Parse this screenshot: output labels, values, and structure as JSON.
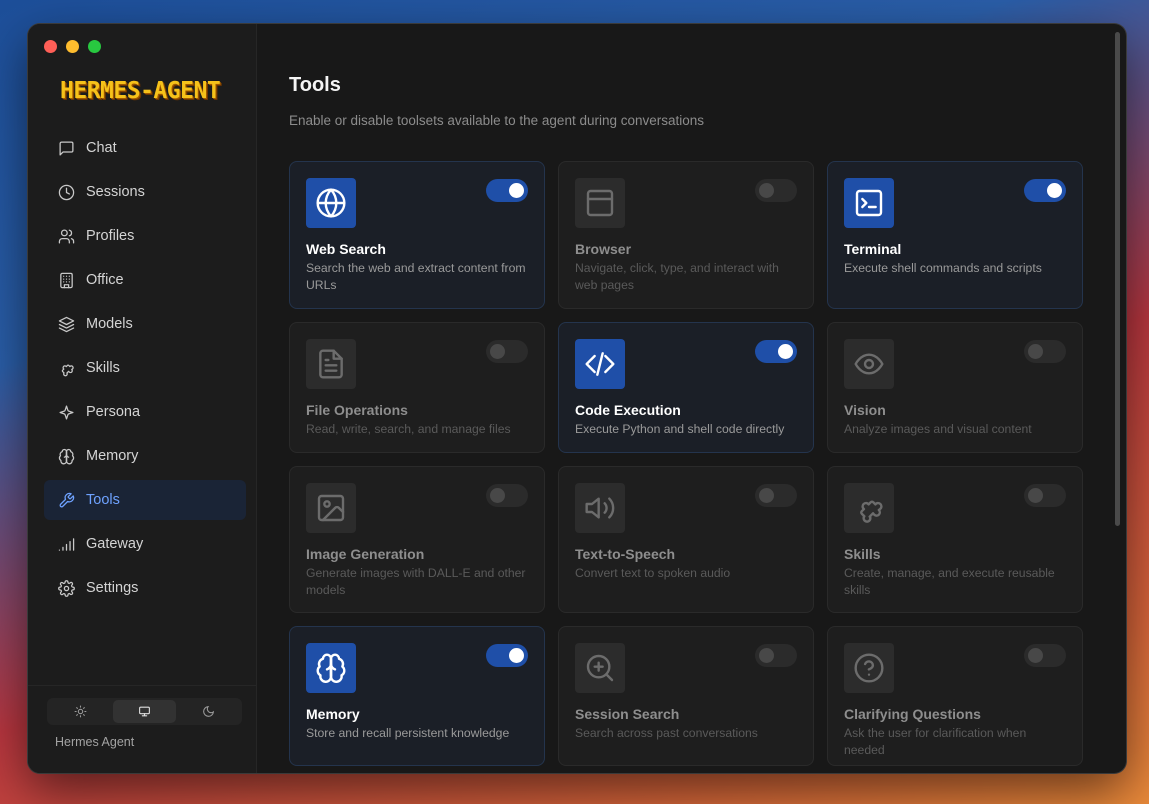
{
  "app": {
    "logo_text": "HERMES-AGENT",
    "footer_name": "Hermes Agent"
  },
  "sidebar": {
    "items": [
      {
        "label": "Chat",
        "icon": "chat-icon",
        "active": false
      },
      {
        "label": "Sessions",
        "icon": "clock-icon",
        "active": false
      },
      {
        "label": "Profiles",
        "icon": "users-icon",
        "active": false
      },
      {
        "label": "Office",
        "icon": "building-icon",
        "active": false
      },
      {
        "label": "Models",
        "icon": "layers-icon",
        "active": false
      },
      {
        "label": "Skills",
        "icon": "puzzle-icon",
        "active": false
      },
      {
        "label": "Persona",
        "icon": "sparkle-icon",
        "active": false
      },
      {
        "label": "Memory",
        "icon": "brain-icon",
        "active": false
      },
      {
        "label": "Tools",
        "icon": "wrench-icon",
        "active": true
      },
      {
        "label": "Gateway",
        "icon": "signal-icon",
        "active": false
      },
      {
        "label": "Settings",
        "icon": "gear-icon",
        "active": false
      }
    ],
    "theme_options": [
      "light",
      "system",
      "dark"
    ],
    "theme_selected": "system"
  },
  "main": {
    "title": "Tools",
    "subtitle": "Enable or disable toolsets available to the agent during conversations",
    "tools": [
      {
        "name": "Web Search",
        "description": "Search the web and extract content from URLs",
        "icon": "globe-icon",
        "enabled": true
      },
      {
        "name": "Browser",
        "description": "Navigate, click, type, and interact with web pages",
        "icon": "browser-window-icon",
        "enabled": false
      },
      {
        "name": "Terminal",
        "description": "Execute shell commands and scripts",
        "icon": "terminal-icon",
        "enabled": true
      },
      {
        "name": "File Operations",
        "description": "Read, write, search, and manage files",
        "icon": "file-icon",
        "enabled": false
      },
      {
        "name": "Code Execution",
        "description": "Execute Python and shell code directly",
        "icon": "code-icon",
        "enabled": true
      },
      {
        "name": "Vision",
        "description": "Analyze images and visual content",
        "icon": "eye-icon",
        "enabled": false
      },
      {
        "name": "Image Generation",
        "description": "Generate images with DALL-E and other models",
        "icon": "image-icon",
        "enabled": false
      },
      {
        "name": "Text-to-Speech",
        "description": "Convert text to spoken audio",
        "icon": "speaker-icon",
        "enabled": false
      },
      {
        "name": "Skills",
        "description": "Create, manage, and execute reusable skills",
        "icon": "puzzle-icon",
        "enabled": false
      },
      {
        "name": "Memory",
        "description": "Store and recall persistent knowledge",
        "icon": "brain-icon",
        "enabled": true
      },
      {
        "name": "Session Search",
        "description": "Search across past conversations",
        "icon": "zoom-search-icon",
        "enabled": false
      },
      {
        "name": "Clarifying Questions",
        "description": "Ask the user for clarification when needed",
        "icon": "question-icon",
        "enabled": false
      }
    ]
  },
  "colors": {
    "accent": "#1f4fa8",
    "active_nav_text": "#6ea2ff",
    "background": "#181818"
  }
}
